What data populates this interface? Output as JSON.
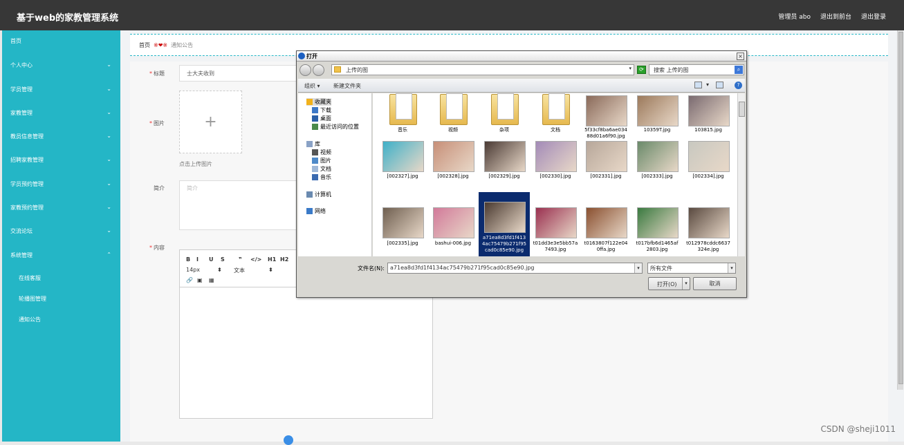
{
  "app": {
    "title": "基于web的家教管理系统"
  },
  "top_links": {
    "admin": "管理员 abo",
    "front": "退出到前台",
    "logout": "退出登录"
  },
  "sidebar": {
    "items": [
      {
        "label": "首页",
        "has_chevron": false
      },
      {
        "label": "个人中心",
        "has_chevron": true
      },
      {
        "label": "学员管理",
        "has_chevron": true
      },
      {
        "label": "家教管理",
        "has_chevron": true
      },
      {
        "label": "教员信息管理",
        "has_chevron": true
      },
      {
        "label": "招聘家教管理",
        "has_chevron": true
      },
      {
        "label": "学员预约管理",
        "has_chevron": true
      },
      {
        "label": "家教预约管理",
        "has_chevron": true
      },
      {
        "label": "交流论坛",
        "has_chevron": true
      },
      {
        "label": "系统管理",
        "has_chevron": true,
        "expanded": true
      }
    ],
    "subitems": [
      "在线客服",
      "轮播图管理",
      "通知公告"
    ],
    "chevron_down": "⌄",
    "chevron_up": "⌃"
  },
  "breadcrumb": {
    "home": "首页",
    "sep": "※❤※",
    "current": "通知公告"
  },
  "form": {
    "title_label": "标题",
    "title_value": "士大夫收到",
    "image_label": "图片",
    "upload_plus": "+",
    "upload_hint": "点击上传图片",
    "intro_label": "简介",
    "intro_placeholder": "简介",
    "content_label": "内容",
    "required_mark": "*"
  },
  "editor": {
    "row1": [
      "B",
      "I",
      "U",
      "S",
      "❞",
      "</>",
      "H1",
      "H2",
      "≡"
    ],
    "font_size": "14px",
    "text_style": "文本",
    "row3": [
      "🔗",
      "▣",
      "▦"
    ]
  },
  "dialog": {
    "title": "打开",
    "close": "×",
    "address": "上传的图",
    "search_placeholder": "搜索 上传的图",
    "organize": "组织 ▾",
    "new_folder": "新建文件夹",
    "nav": [
      {
        "label": "收藏夹",
        "indent": 0,
        "selected": true,
        "icon": "star-icon"
      },
      {
        "label": "下载",
        "indent": 1,
        "icon": "download-icon"
      },
      {
        "label": "桌面",
        "indent": 1,
        "icon": "desktop-icon"
      },
      {
        "label": "最近访问的位置",
        "indent": 1,
        "icon": "recent-icon"
      },
      {
        "label": "库",
        "indent": 0,
        "icon": "library-icon"
      },
      {
        "label": "视频",
        "indent": 1,
        "icon": "video-icon"
      },
      {
        "label": "图片",
        "indent": 1,
        "icon": "picture-icon"
      },
      {
        "label": "文档",
        "indent": 1,
        "icon": "document-icon"
      },
      {
        "label": "音乐",
        "indent": 1,
        "icon": "music-icon"
      },
      {
        "label": "计算机",
        "indent": 0,
        "icon": "computer-icon"
      },
      {
        "label": "网络",
        "indent": 0,
        "icon": "network-icon"
      }
    ],
    "files": [
      {
        "name": "音乐",
        "kind": "folder"
      },
      {
        "name": "视频",
        "kind": "folder"
      },
      {
        "name": "杂项",
        "kind": "folder"
      },
      {
        "name": "文档",
        "kind": "folder"
      },
      {
        "name": "5f33cf8ba6ae034\n88d01a6f90.jpg",
        "kind": "image",
        "color": "#8a6a5a"
      },
      {
        "name": "10359T.jpg",
        "kind": "image",
        "color": "#9c7a5c"
      },
      {
        "name": "103815.jpg",
        "kind": "image",
        "color": "#7a6a70"
      },
      {
        "name": "[002327].jpg",
        "kind": "image",
        "color": "#3fb0c8"
      },
      {
        "name": "[002328].jpg",
        "kind": "image",
        "color": "#c78f78"
      },
      {
        "name": "[002329].jpg",
        "kind": "image",
        "color": "#4a3a34"
      },
      {
        "name": "[002330].jpg",
        "kind": "image",
        "color": "#a38bb8"
      },
      {
        "name": "[002331].jpg",
        "kind": "image",
        "color": "#b7a79a"
      },
      {
        "name": "[002333].jpg",
        "kind": "image",
        "color": "#6a8a6a"
      },
      {
        "name": "[002334].jpg",
        "kind": "image",
        "color": "#c8c8c0"
      },
      {
        "name": "[002335].jpg",
        "kind": "image",
        "color": "#6f5f50"
      },
      {
        "name": "bashui-006.jpg",
        "kind": "image",
        "color": "#d27a9a"
      },
      {
        "name": "a71ea8d3fd1f413\n4ac75479b271f95\ncad0c85e90.jpg",
        "kind": "image",
        "color": "#4a3a30",
        "selected": true
      },
      {
        "name": "t01dd3e3e5bb57a\n7493.jpg",
        "kind": "image",
        "color": "#9a3050"
      },
      {
        "name": "t0163807f122e04\n0ffa.jpg",
        "kind": "image",
        "color": "#8a5030"
      },
      {
        "name": "t017bfb6d1465af\n2803.jpg",
        "kind": "image",
        "color": "#3a7a40"
      },
      {
        "name": "t012978cddc6637\n324e.jpg",
        "kind": "image",
        "color": "#5a4a40"
      }
    ],
    "filename_label": "文件名(N):",
    "filename_value": "a71ea8d3fd1f4134ac75479b271f95cad0c85e90.jpg",
    "filetype": "所有文件",
    "open_label": "打开(O)",
    "cancel_label": "取消",
    "dropdown_arrow": "▾"
  },
  "watermark": "CSDN @sheji1011"
}
